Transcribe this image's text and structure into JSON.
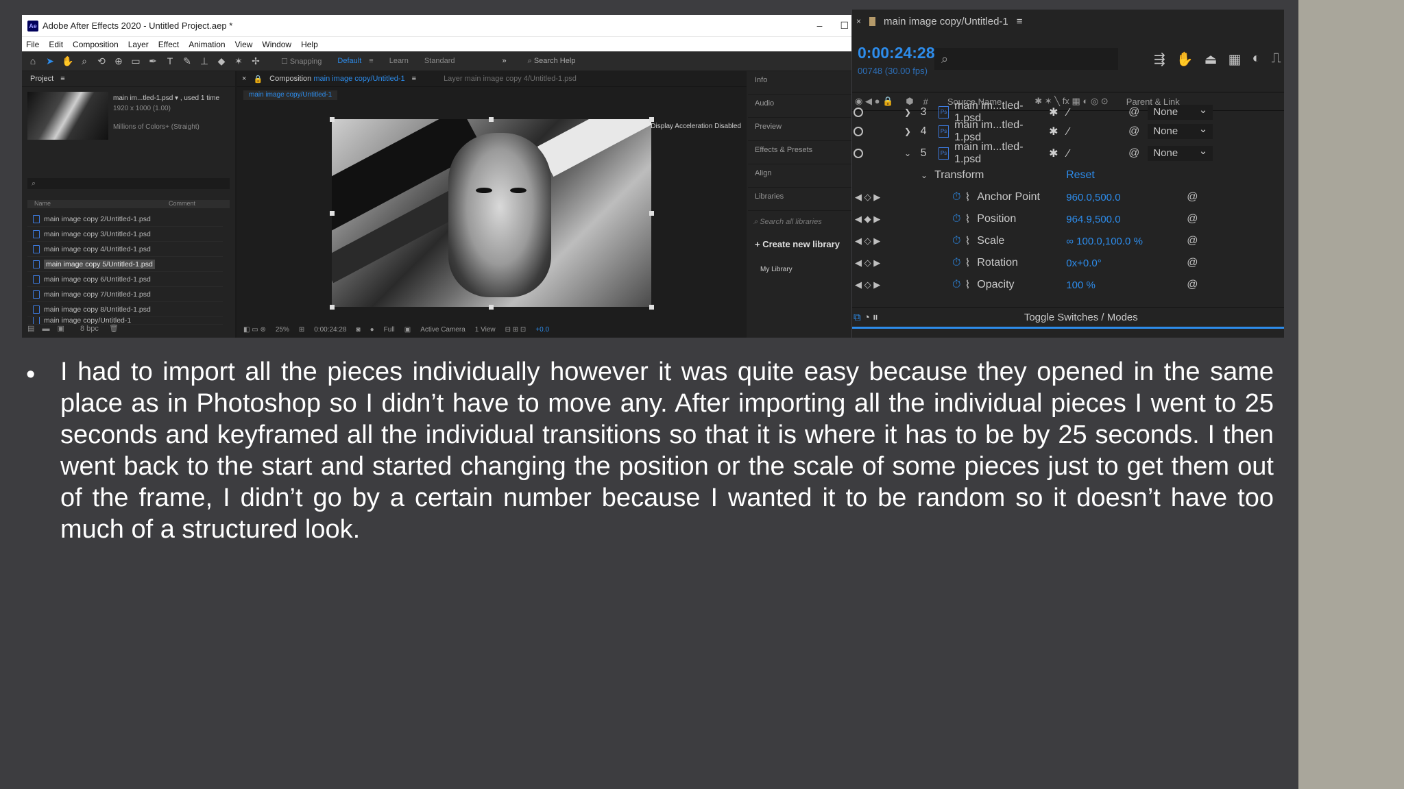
{
  "window": {
    "title": "Adobe After Effects 2020 - Untitled Project.aep *",
    "logo": "Ae"
  },
  "menu": [
    "File",
    "Edit",
    "Composition",
    "Layer",
    "Effect",
    "Animation",
    "View",
    "Window",
    "Help"
  ],
  "toolbar": {
    "snapping": "Snapping",
    "workspaces": [
      "Default",
      "Learn",
      "Standard"
    ],
    "search_help": "Search Help"
  },
  "project": {
    "tab": "Project",
    "item_name": "main im...tled-1.psd ▾ , used 1 time",
    "item_size": "1920 x 1000 (1.00)",
    "item_colors": "Millions of Colors+ (Straight)",
    "col_name": "Name",
    "col_comment": "Comment",
    "items": [
      "main image copy 2/Untitled-1.psd",
      "main image copy 3/Untitled-1.psd",
      "main image copy 4/Untitled-1.psd",
      "main image copy 5/Untitled-1.psd",
      "main image copy 6/Untitled-1.psd",
      "main image copy 7/Untitled-1.psd",
      "main image copy 8/Untitled-1.psd",
      "main image copy/Untitled-1"
    ],
    "selected_index": 3,
    "bpc": "8 bpc"
  },
  "composition": {
    "tab_prefix": "Composition",
    "tab_name": "main image copy/Untitled-1",
    "layer_tab": "Layer main image copy 4/Untitled-1.psd",
    "breadcrumb": "main image copy/Untitled-1",
    "accel_note": "Display Acceleration Disabled",
    "zoom": "25%",
    "timecode": "0:00:24:28",
    "resolution": "Full",
    "camera": "Active Camera",
    "views": "1 View",
    "exposure": "+0.0"
  },
  "side_panel": {
    "items": [
      "Info",
      "Audio",
      "Preview",
      "Effects & Presets",
      "Align",
      "Libraries"
    ],
    "search_libraries": "Search all libraries",
    "create_library": "+ Create new library",
    "my_library": "My Library"
  },
  "timeline": {
    "tab": "main image copy/Untitled-1",
    "time": "0:00:24:28",
    "fps": "00748 (30.00 fps)",
    "col_hash": "#",
    "col_source": "Source Name",
    "col_parent": "Parent & Link",
    "layers": [
      {
        "num": "3",
        "name": "main im...tled-1.psd",
        "parent": "None"
      },
      {
        "num": "4",
        "name": "main im...tled-1.psd",
        "parent": "None"
      },
      {
        "num": "5",
        "name": "main im...tled-1.psd",
        "parent": "None"
      }
    ],
    "transform_label": "Transform",
    "reset_label": "Reset",
    "properties": [
      {
        "name": "Anchor Point",
        "value": "960.0,500.0"
      },
      {
        "name": "Position",
        "value": "964.9,500.0"
      },
      {
        "name": "Scale",
        "value": "∞ 100.0,100.0 %"
      },
      {
        "name": "Rotation",
        "value": "0x+0.0°"
      },
      {
        "name": "Opacity",
        "value": "100 %"
      }
    ],
    "toggle_label": "Toggle Switches / Modes"
  },
  "slide": {
    "bullet": "•",
    "text": "I had to import all the pieces individually however it was quite easy because they opened in the same place as in Photoshop so I didn’t have to move any. After importing all the individual pieces I went to 25 seconds and keyframed all the individual transitions so that it is where it has to be by 25 seconds. I then went back to the start and started changing the position or the scale of some pieces just to get them out of the frame, I didn’t go by a certain number because I wanted it to be random so it doesn’t have too much of a structured look."
  }
}
